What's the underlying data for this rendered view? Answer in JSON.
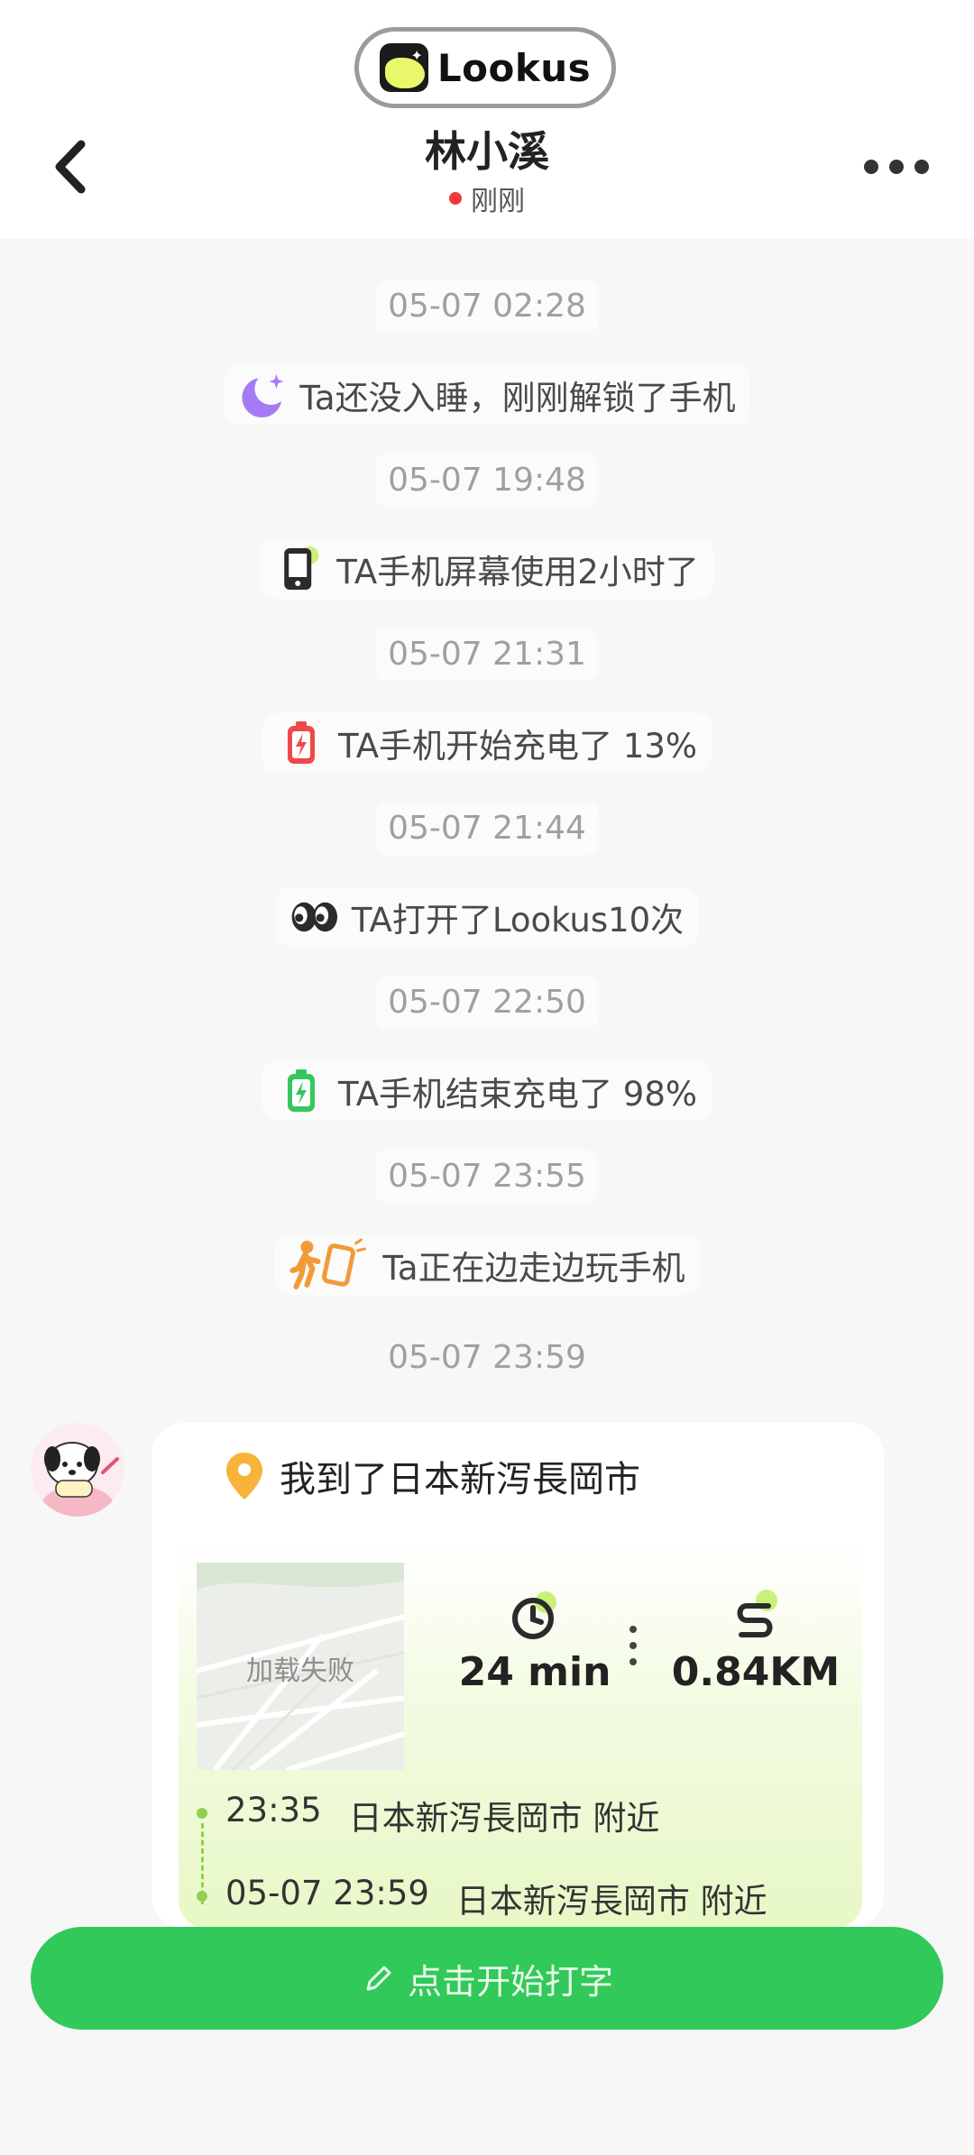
{
  "header": {
    "brand": "Lookus",
    "contact_name": "林小溪",
    "status": "刚刚",
    "status_color": "#ef3b3b"
  },
  "timeline": [
    {
      "time": "05-07 02:28",
      "event": "Ta还没入睡，刚刚解锁了手机",
      "icon": "moon-icon"
    },
    {
      "time": "05-07 19:48",
      "event": "TA手机屏幕使用2小时了",
      "icon": "phone-screen-icon"
    },
    {
      "time": "05-07 21:31",
      "event": "TA手机开始充电了 13%",
      "icon": "battery-low-icon"
    },
    {
      "time": "05-07 21:44",
      "event": "TA打开了Lookus10次",
      "icon": "eyes-icon"
    },
    {
      "time": "05-07 22:50",
      "event": "TA手机结束充电了 98%",
      "icon": "battery-full-icon"
    },
    {
      "time": "05-07 23:55",
      "event": "Ta正在边走边玩手机",
      "icon": "walking-phone-icon"
    }
  ],
  "last_time": "05-07 23:59",
  "location_card": {
    "title": "我到了日本新泻長岡市",
    "map_failed": "加载失败",
    "duration": "24 min",
    "distance": "0.84KM",
    "track": [
      {
        "time": "23:35",
        "place": "日本新泻長岡市 附近"
      },
      {
        "time": "05-07 23:59",
        "place": "日本新泻長岡市 附近"
      }
    ]
  },
  "compose": {
    "label": "点击开始打字",
    "color": "#31c95a"
  }
}
